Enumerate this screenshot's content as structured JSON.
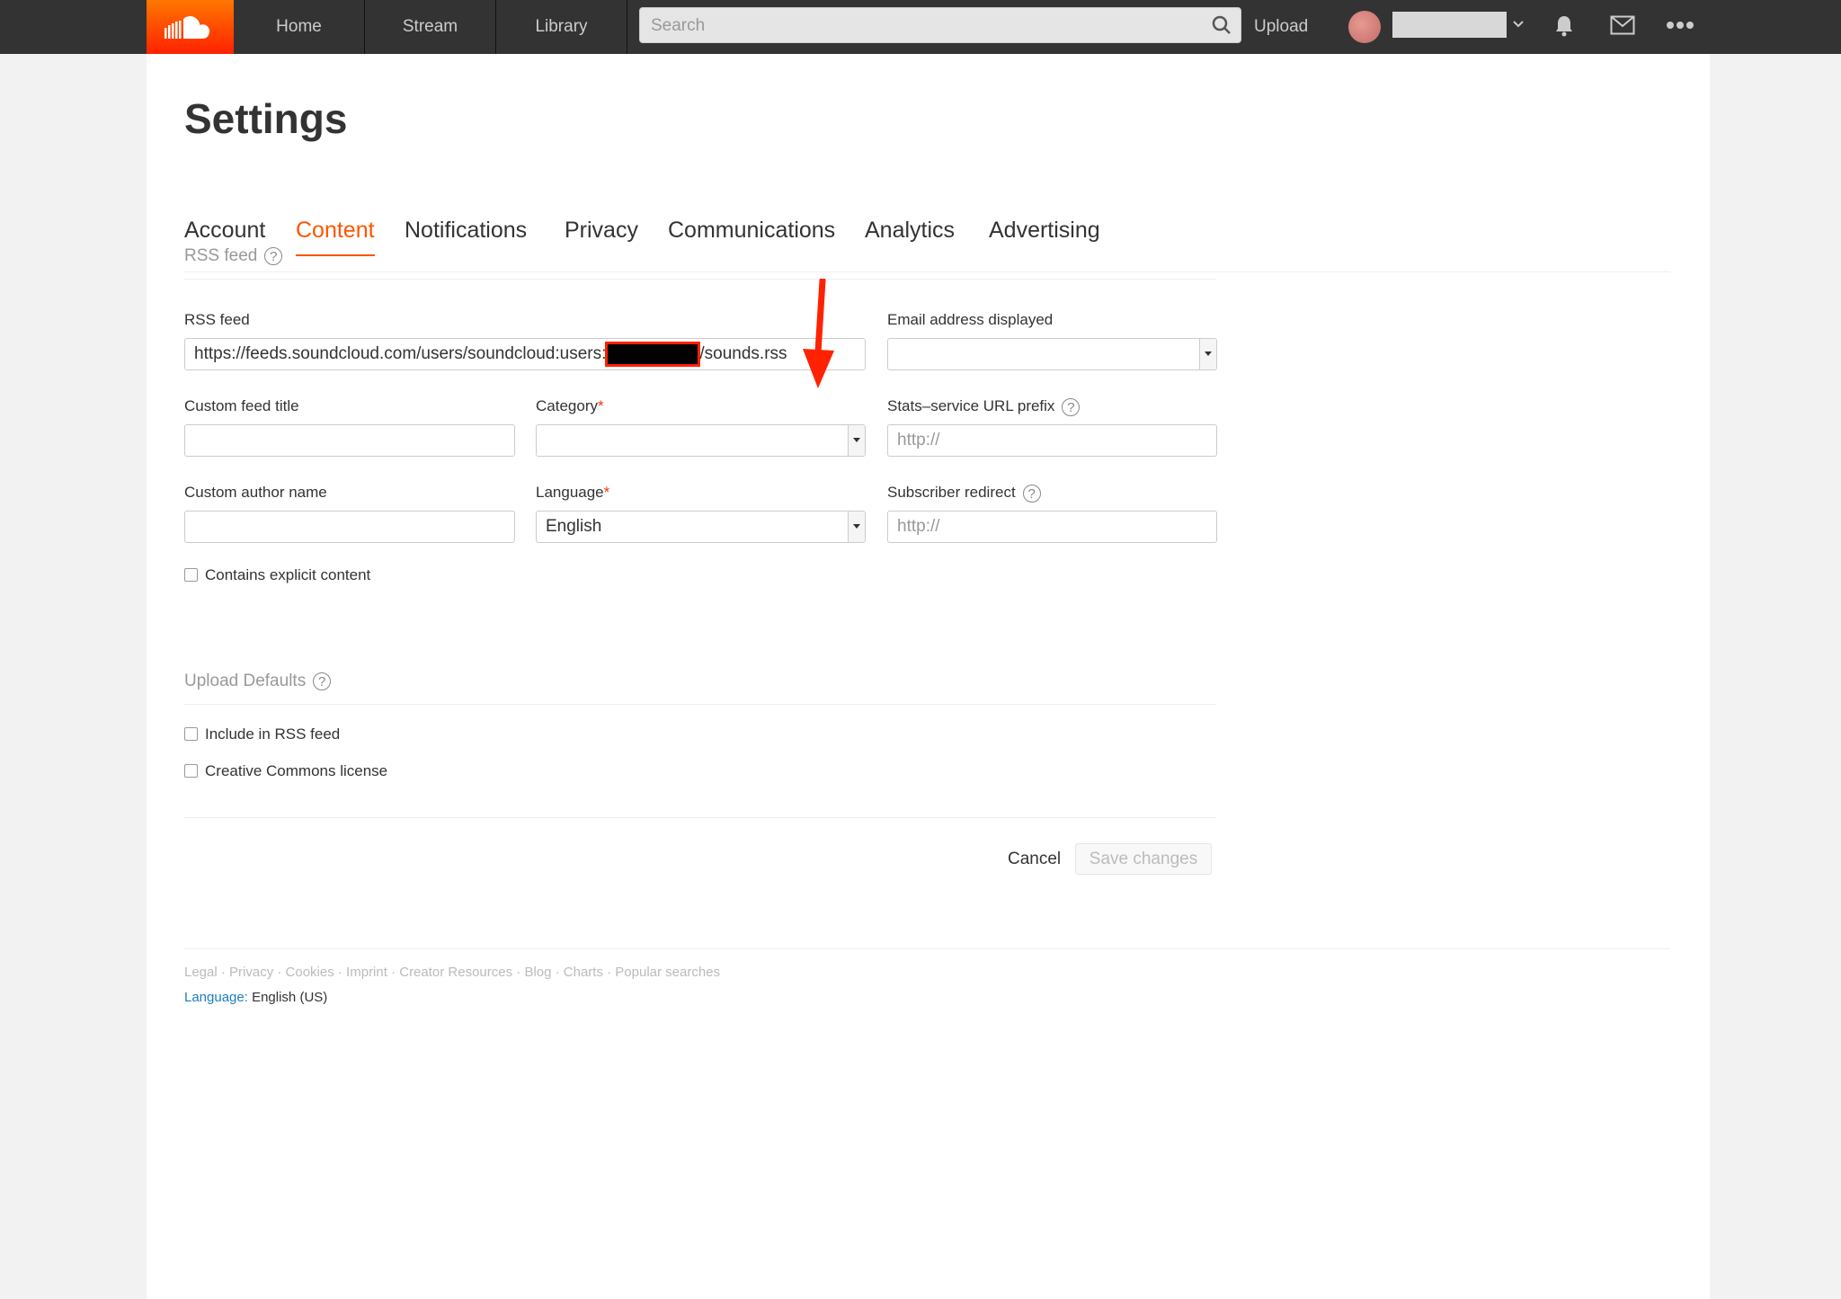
{
  "nav": {
    "home": "Home",
    "stream": "Stream",
    "library": "Library",
    "search_placeholder": "Search",
    "upload": "Upload"
  },
  "page": {
    "title": "Settings",
    "tabs": [
      {
        "label": "Account"
      },
      {
        "label": "Content"
      },
      {
        "label": "Notifications"
      },
      {
        "label": "Privacy"
      },
      {
        "label": "Communications"
      },
      {
        "label": "Analytics"
      },
      {
        "label": "Advertising"
      }
    ],
    "active_tab": "Content"
  },
  "rss_section": {
    "header": "RSS feed",
    "rss_feed_label": "RSS feed",
    "rss_feed_prefix": "https://feeds.soundcloud.com/users/soundcloud:users:",
    "rss_feed_suffix": "/sounds.rss",
    "email_label": "Email address displayed",
    "email_value": "",
    "custom_title_label": "Custom feed title",
    "category_label": "Category",
    "category_value": "",
    "stats_label": "Stats–service URL prefix",
    "stats_placeholder": "http://",
    "author_label": "Custom author name",
    "language_label": "Language",
    "language_value": "English",
    "redirect_label": "Subscriber redirect",
    "redirect_placeholder": "http://",
    "explicit_label": "Contains explicit content",
    "required_marker": "*"
  },
  "upload_defaults": {
    "header": "Upload Defaults",
    "include_rss": "Include in RSS feed",
    "cc_license": "Creative Commons license"
  },
  "actions": {
    "cancel": "Cancel",
    "save": "Save changes"
  },
  "footer": {
    "links": "Legal · Privacy · Cookies · Imprint · Creator Resources · Blog · Charts · Popular searches",
    "language_key": "Language:",
    "language_value": "English (US)"
  },
  "colors": {
    "accent": "#ff5500",
    "annotation": "#ff2200"
  }
}
